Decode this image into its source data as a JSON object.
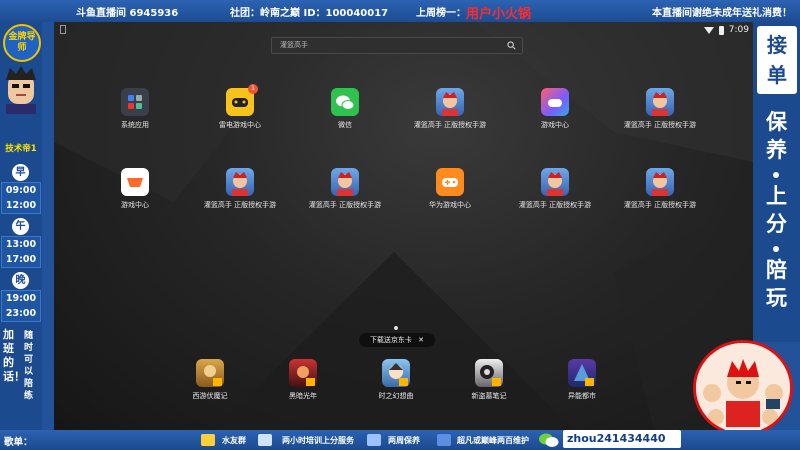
{
  "topbar": {
    "room": "斗鱼直播间 6945936",
    "club": "社团：岭南之巅 ID：100040017",
    "last_week": "上周榜一：",
    "top_fan": "用户小火锅",
    "notice": "本直播间谢绝未成年送礼消费！"
  },
  "left_panel": {
    "badge": "金牌导师",
    "tech_label": "技术帝1",
    "slots": [
      {
        "label": "早",
        "start": "09:00",
        "end": "12:00"
      },
      {
        "label": "午",
        "start": "13:00",
        "end": "17:00"
      },
      {
        "label": "晚",
        "start": "19:00",
        "end": "23:00"
      }
    ],
    "overtime": "加班的话！",
    "anytime": "随时可以陪练"
  },
  "phone": {
    "status_time": "7:09",
    "search_placeholder": "灌篮高手",
    "apps_row1": [
      {
        "label": "系统应用",
        "icon": "system-apps-folder-icon"
      },
      {
        "label": "雷电游戏中心",
        "icon": "leidian-game-center-icon",
        "badge": "1"
      },
      {
        "label": "微信",
        "icon": "wechat-icon"
      },
      {
        "label": "灌篮高手 正版授权手游",
        "icon": "slam-dunk-icon"
      },
      {
        "label": "游戏中心",
        "icon": "game-center-icon"
      },
      {
        "label": "灌篮高手 正版授权手游",
        "icon": "slam-dunk-icon"
      }
    ],
    "apps_row2": [
      {
        "label": "游戏中心",
        "icon": "game-center-orange-icon"
      },
      {
        "label": "灌篮高手 正版授权手游",
        "icon": "slam-dunk-icon"
      },
      {
        "label": "灌篮高手 正版授权手游",
        "icon": "slam-dunk-icon"
      },
      {
        "label": "华为游戏中心",
        "icon": "huawei-game-center-icon"
      },
      {
        "label": "灌篮高手 正版授权手游",
        "icon": "slam-dunk-icon"
      },
      {
        "label": "灌篮高手 正版授权手游",
        "icon": "slam-dunk-icon"
      }
    ],
    "toast": "下载送京东卡",
    "dock": [
      {
        "label": "西游伏魔记",
        "icon": "xiyou-icon"
      },
      {
        "label": "黑暗光年",
        "icon": "dark-lightyear-icon"
      },
      {
        "label": "时之幻想曲",
        "icon": "time-fantasia-icon"
      },
      {
        "label": "新盗墓笔记",
        "icon": "tomb-notes-icon"
      },
      {
        "label": "异能都市",
        "icon": "super-city-icon"
      }
    ]
  },
  "right_panel": {
    "jiedan": "接单",
    "services": [
      "保养",
      "上分",
      "陪玩"
    ]
  },
  "bottombar": {
    "song": "歌单：",
    "items": [
      "水友群",
      "两小时培训上分服务",
      "两周保养",
      "超凡或巅峰两百维护"
    ],
    "wechat_id": "zhou241434440"
  },
  "colors": {
    "frame_blue": "#22529a",
    "top_fan_red": "#ff2a2a",
    "gold": "#ffd400"
  }
}
